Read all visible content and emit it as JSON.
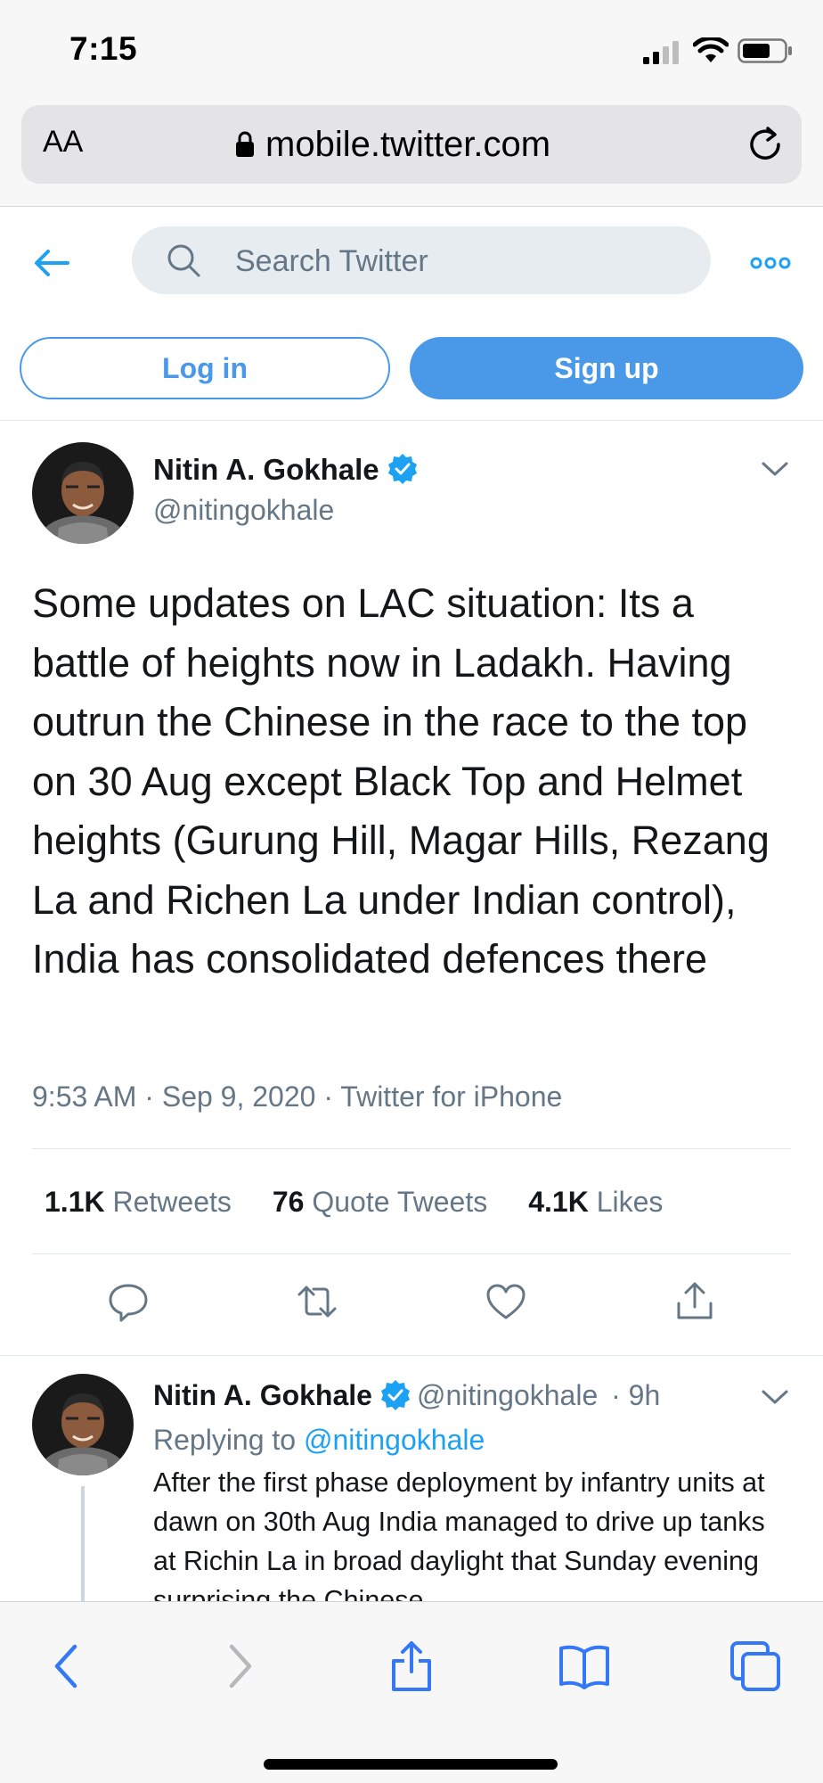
{
  "status_bar": {
    "time": "7:15"
  },
  "browser": {
    "text_size_label": "AA",
    "url": "mobile.twitter.com"
  },
  "header": {
    "search_placeholder": "Search Twitter",
    "login_label": "Log in",
    "signup_label": "Sign up"
  },
  "tweet": {
    "author_name": "Nitin A. Gokhale",
    "author_handle": "@nitingokhale",
    "text": "Some updates on LAC situation: Its a battle of heights now in Ladakh. Having outrun the Chinese in the race to the top  on 30 Aug except Black Top and Helmet heights (Gurung Hill, Magar Hills, Rezang La and Richen La under Indian control), India has consolidated defences there",
    "time": "9:53 AM",
    "date": "Sep 9, 2020",
    "source": "Twitter for iPhone",
    "retweets_count": "1.1K",
    "retweets_label": "Retweets",
    "quotes_count": "76",
    "quotes_label": "Quote Tweets",
    "likes_count": "4.1K",
    "likes_label": "Likes"
  },
  "reply": {
    "author_name": "Nitin A. Gokhale",
    "author_handle": "@nitingokhale",
    "age": "9h",
    "replying_prefix": "Replying to",
    "replying_to": "@nitingokhale",
    "text": "After the first phase deployment by infantry units at dawn on 30th Aug India managed to drive up tanks at Richin La in broad daylight that Sunday evening surprising the Chinese"
  },
  "colors": {
    "twitter_blue": "#1da1f2",
    "button_blue": "#4a99e9",
    "ios_blue": "#3478f6",
    "muted_text": "#657786"
  },
  "icons": [
    "signal-icon",
    "wifi-icon",
    "battery-icon",
    "lock-icon",
    "reload-icon",
    "back-arrow-icon",
    "search-icon",
    "more-icon",
    "verified-icon",
    "chevron-down-icon",
    "reply-icon",
    "retweet-icon",
    "like-icon",
    "share-icon",
    "safari-back-icon",
    "safari-forward-icon",
    "safari-share-icon",
    "bookmarks-icon",
    "tabs-icon"
  ]
}
